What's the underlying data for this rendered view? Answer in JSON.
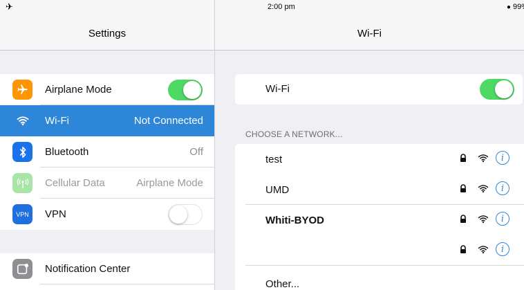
{
  "status_bar": {
    "time": "2:00 pm",
    "battery": "99%",
    "airplane_glyph": "✈"
  },
  "left": {
    "title": "Settings",
    "group1": [
      {
        "label": "Airplane Mode",
        "icon": "airplane-icon",
        "icon_color": "#ff9500",
        "toggle": true
      },
      {
        "label": "Wi-Fi",
        "icon": "wifi-icon",
        "icon_color": "#2d86d8",
        "value": "Not Connected",
        "selected": true
      },
      {
        "label": "Bluetooth",
        "icon": "bluetooth-icon",
        "icon_color": "#1a73e8",
        "value": "Off"
      },
      {
        "label": "Cellular Data",
        "icon": "cellular-icon",
        "icon_color": "#a8e6a8",
        "value": "Airplane Mode",
        "disabled": true
      },
      {
        "label": "VPN",
        "icon": "vpn-icon",
        "icon_color": "#1e6fe0",
        "icon_text": "VPN",
        "toggle": false
      }
    ],
    "group2": [
      {
        "label": "Notification Center",
        "icon": "notification-center-icon",
        "icon_color": "#8e8e93"
      }
    ]
  },
  "right": {
    "title": "Wi-Fi",
    "wifi_label": "Wi-Fi",
    "wifi_on": true,
    "section_header": "CHOOSE A NETWORK...",
    "networks": [
      {
        "name": "test",
        "bold": false
      },
      {
        "name": "UMD",
        "bold": false
      },
      {
        "name": "Whiti-BYOD",
        "bold": true
      },
      {
        "name": "",
        "bold": false
      }
    ],
    "other_label": "Other...",
    "info_glyph": "i"
  },
  "colors": {
    "accent": "#2d86d8",
    "toggle_on": "#4cd964",
    "background": "#efeff4"
  }
}
